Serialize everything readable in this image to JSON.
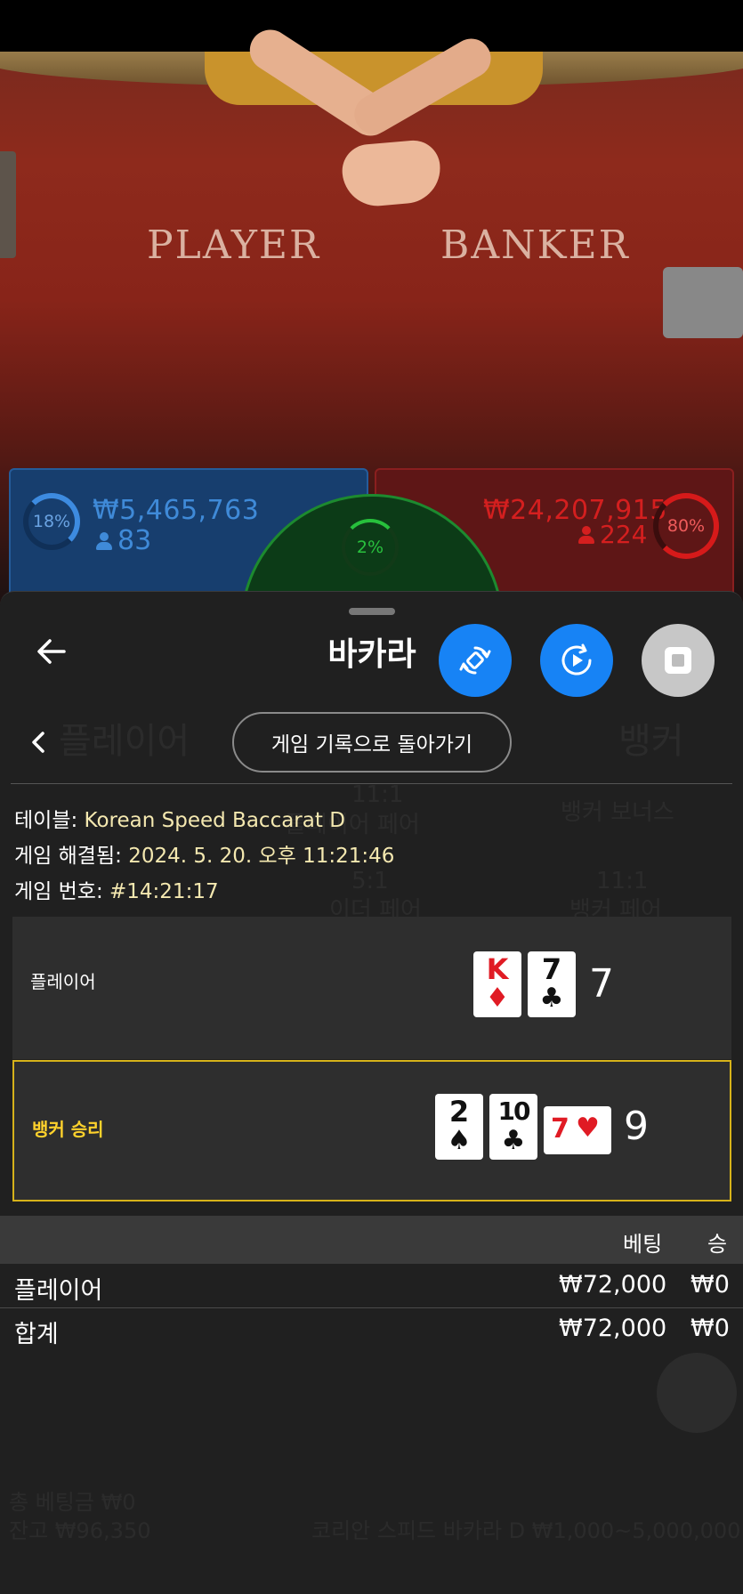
{
  "video": {
    "player_word": "PLAYER",
    "banker_word": "BANKER"
  },
  "stats": {
    "player_percent": "18%",
    "player_amount": "₩5,465,763",
    "player_count": "83",
    "tie_percent": "2%",
    "banker_amount": "₩24,207,915",
    "banker_count": "224",
    "banker_percent": "80%",
    "colors": {
      "player": "#3d8be0",
      "banker": "#d61a1a",
      "tie": "#29c13e"
    }
  },
  "panel": {
    "title": "바카라",
    "history_button": "게임 기록으로 돌아가기",
    "ghost": {
      "player": "플레이어",
      "banker": "뱅커",
      "player_pair_odds": "11:1",
      "player_pair": "플레이어 페어",
      "banker_bonus": "뱅커 보너스",
      "either_pair_odds": "5:1",
      "either_pair": "이더 페어",
      "banker_pair_odds": "11:1",
      "banker_pair": "뱅커 페어",
      "total_bet": "총 베팅금 ₩0",
      "balance": "잔고 ₩96,350",
      "table_limits": "코리안 스피드 바카라 D ₩1,000~5,000,000"
    },
    "info": {
      "table_label": "테이블:",
      "table_value": "Korean Speed Baccarat D",
      "resolved_label": "게임 해결됨:",
      "resolved_value": "2024. 5. 20. 오후 11:21:46",
      "game_no_label": "게임 번호:",
      "game_no_value": "#14:21:17"
    },
    "result": {
      "player_label": "플레이어",
      "player_cards": [
        {
          "rank": "K",
          "suit": "♦",
          "color": "red"
        },
        {
          "rank": "7",
          "suit": "♣",
          "color": "black"
        }
      ],
      "player_score": "7",
      "banker_label": "뱅커 승리",
      "banker_cards": [
        {
          "rank": "2",
          "suit": "♠",
          "color": "black"
        },
        {
          "rank": "10",
          "suit": "♣",
          "color": "black"
        },
        {
          "rank": "7",
          "suit": "♥",
          "color": "red",
          "sideways": true
        }
      ],
      "banker_score": "9"
    },
    "bets": {
      "header_bet": "베팅",
      "header_win": "승",
      "rows": [
        {
          "name": "플레이어",
          "bet": "₩72,000",
          "win": "₩0"
        }
      ],
      "total": {
        "name": "합계",
        "bet": "₩72,000",
        "win": "₩0"
      }
    }
  }
}
